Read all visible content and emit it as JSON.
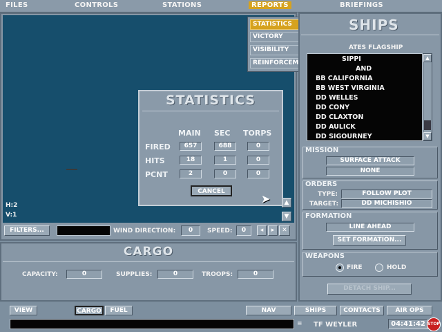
{
  "menu": {
    "files": "FILES",
    "controls": "CONTROLS",
    "stations": "STATIONS",
    "reports": "REPORTS",
    "briefings": "BRIEFINGS"
  },
  "reports_menu": [
    {
      "label": "STATISTICS",
      "key": "Alt-F1"
    },
    {
      "label": "VICTORY",
      "key": "Alt-F2"
    },
    {
      "label": "VISIBILITY",
      "key": "Alt-F3"
    },
    {
      "label": "REINFORCEMENTS",
      "key": "Alt-F4"
    }
  ],
  "statistics": {
    "title": "STATISTICS",
    "headers": [
      "MAIN",
      "SEC",
      "TORPS"
    ],
    "rows": [
      {
        "label": "FIRED",
        "values": [
          "657",
          "688",
          "0"
        ]
      },
      {
        "label": "HITS",
        "values": [
          "18",
          "1",
          "0"
        ]
      },
      {
        "label": "PCNT",
        "values": [
          "2",
          "0",
          "0"
        ]
      }
    ],
    "cancel": "CANCEL"
  },
  "map": {
    "h_readout": "H:2",
    "v_readout": "V:1"
  },
  "map_toolbar": {
    "filters": "FILTERS...",
    "wind_label": "WIND DIRECTION:",
    "wind_value": "0",
    "speed_label": "SPEED:",
    "speed_value": "0"
  },
  "cargo": {
    "title": "CARGO",
    "capacity_label": "CAPACITY:",
    "capacity": "0",
    "supplies_label": "SUPPLIES:",
    "supplies": "0",
    "troops_label": "TROOPS:",
    "troops": "0"
  },
  "ships_panel": {
    "title": "SHIPS",
    "flagship_header": "ATES FLAGSHIP",
    "ships": [
      "SIPPI",
      "AND",
      "BB CALIFORNIA",
      "BB WEST VIRGINIA",
      "DD WELLES",
      "DD CONY",
      "DD CLAXTON",
      "DD AULICK",
      "DD SIGOURNEY"
    ]
  },
  "mission": {
    "title": "MISSION",
    "type": "SURFACE ATTACK",
    "sub": "NONE"
  },
  "orders": {
    "title": "ORDERS",
    "type_label": "TYPE:",
    "type": "FOLLOW PLOT",
    "target_label": "TARGET:",
    "target": "DD  MICHISHIO"
  },
  "formation": {
    "title": "FORMATION",
    "value": "LINE AHEAD",
    "set_button": "SET FORMATION..."
  },
  "weapons": {
    "title": "WEAPONS",
    "fire": "FIRE",
    "hold": "HOLD"
  },
  "detach": "DETACH SHIP...",
  "bottom_tabs": {
    "view": "VIEW",
    "cargo": "CARGO",
    "fuel": "FUEL",
    "nav": "NAV",
    "ships": "SHIPS",
    "contacts": "CONTACTS",
    "air_ops": "AIR OPS"
  },
  "status": {
    "group": "TF WEYLER",
    "time": "04:41:42",
    "speed": "x4",
    "stop": "STOP"
  }
}
